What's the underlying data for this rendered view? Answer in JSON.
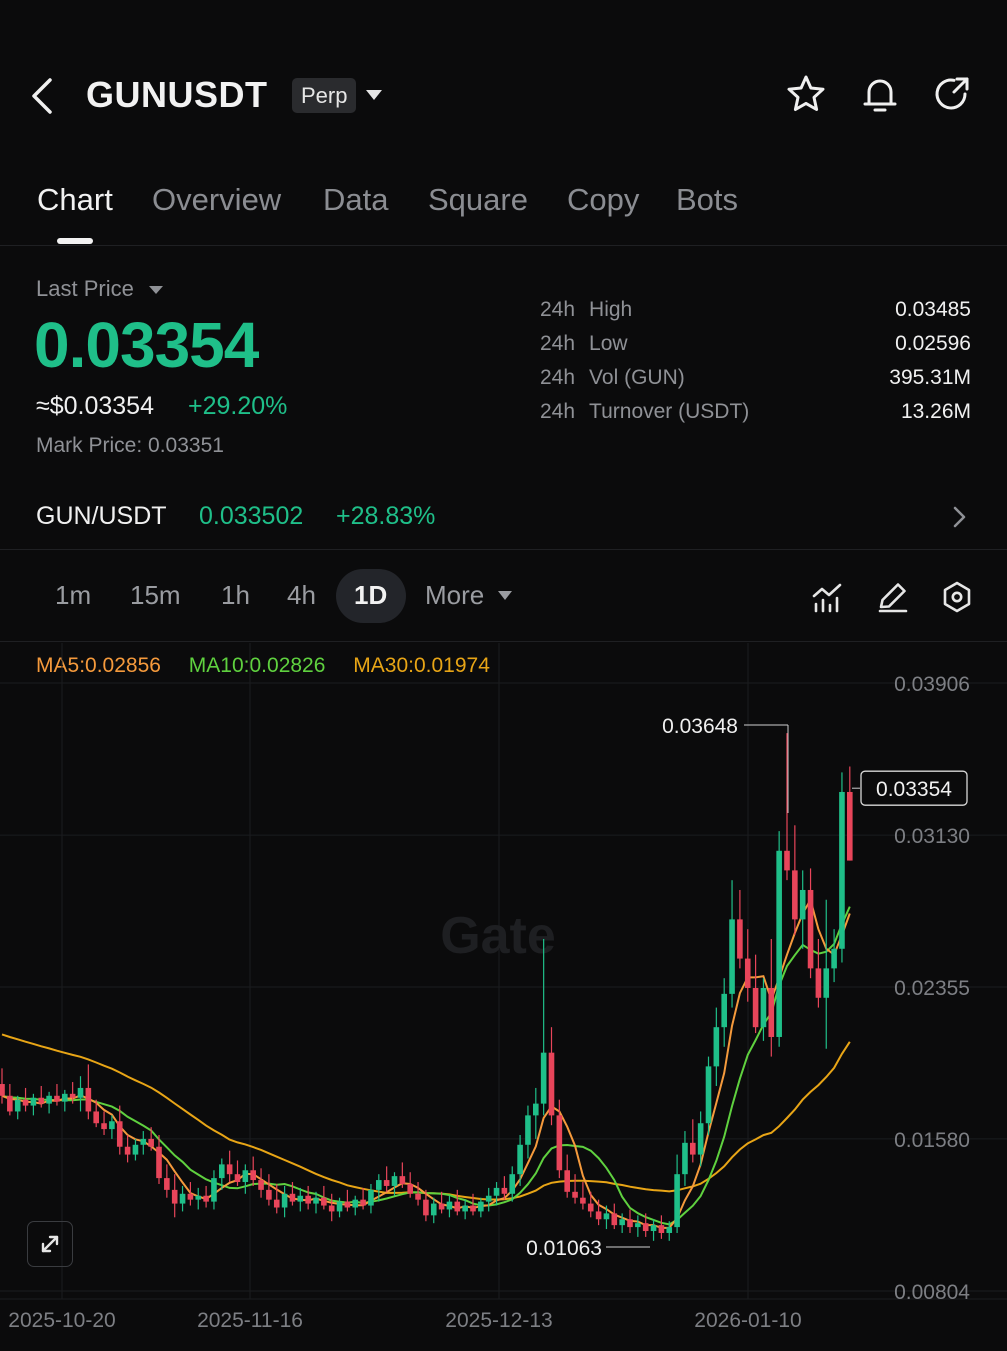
{
  "header": {
    "title": "GUNUSDT",
    "badge": "Perp",
    "icons": [
      "back-icon",
      "star-icon",
      "bell-icon",
      "share-icon"
    ]
  },
  "tabs": [
    {
      "label": "Chart",
      "active": true
    },
    {
      "label": "Overview"
    },
    {
      "label": "Data"
    },
    {
      "label": "Square"
    },
    {
      "label": "Copy"
    },
    {
      "label": "Bots"
    }
  ],
  "ticker": {
    "last_price_label": "Last Price",
    "last_price": "0.03354",
    "usd_price": "≈$0.03354",
    "change": "+29.20%",
    "mark_price": "Mark Price:  0.03351",
    "stats": [
      {
        "period": "24h",
        "label": "High",
        "value": "0.03485"
      },
      {
        "period": "24h",
        "label": "Low",
        "value": "0.02596"
      },
      {
        "period": "24h",
        "label": "Vol (GUN)",
        "value": "395.31M"
      },
      {
        "period": "24h",
        "label": "Turnover (USDT)",
        "value": "13.26M"
      }
    ]
  },
  "spot": {
    "pair": "GUN/USDT",
    "price": "0.033502",
    "change": "+28.83%"
  },
  "intervals": {
    "items": [
      "1m",
      "15m",
      "1h",
      "4h",
      "1D",
      "More"
    ],
    "selected": "1D"
  },
  "colors": {
    "up": "#1fbf89",
    "down": "#e8455a",
    "ma5": "#f59a3c",
    "ma10": "#5fd13f",
    "ma30": "#e8a516",
    "bg": "#0b0b0c"
  },
  "chart_data": {
    "type": "candlestick",
    "ma_legend": [
      {
        "name": "MA5",
        "value": "0.02856",
        "color": "#f59a3c"
      },
      {
        "name": "MA10",
        "value": "0.02826",
        "color": "#5fd13f"
      },
      {
        "name": "MA30",
        "value": "0.01974",
        "color": "#e8a516"
      }
    ],
    "y_ticks": [
      "0.03906",
      "0.03130",
      "0.02355",
      "0.01580",
      "0.00804"
    ],
    "ylim": [
      0.00804,
      0.03906
    ],
    "x_ticks": [
      "2025-10-20",
      "2025-11-16",
      "2025-12-13",
      "2026-01-10"
    ],
    "current_price": "0.03354",
    "annotations": {
      "high": "0.03648",
      "low": "0.01063"
    },
    "watermark": "Gate",
    "candles": [
      [
        0.0186,
        0.0194,
        0.0176,
        0.018
      ],
      [
        0.018,
        0.0186,
        0.017,
        0.0172
      ],
      [
        0.0172,
        0.018,
        0.0168,
        0.0178
      ],
      [
        0.0178,
        0.0184,
        0.0172,
        0.0175
      ],
      [
        0.0175,
        0.0181,
        0.017,
        0.0179
      ],
      [
        0.0179,
        0.0185,
        0.0174,
        0.0176
      ],
      [
        0.0176,
        0.0182,
        0.0171,
        0.018
      ],
      [
        0.018,
        0.0186,
        0.0175,
        0.0177
      ],
      [
        0.0177,
        0.0183,
        0.0172,
        0.0181
      ],
      [
        0.0181,
        0.0187,
        0.0176,
        0.0179
      ],
      [
        0.0179,
        0.019,
        0.0172,
        0.0184
      ],
      [
        0.0184,
        0.0196,
        0.0168,
        0.0172
      ],
      [
        0.0172,
        0.0178,
        0.0164,
        0.0166
      ],
      [
        0.0166,
        0.0172,
        0.016,
        0.0163
      ],
      [
        0.0163,
        0.017,
        0.0158,
        0.0167
      ],
      [
        0.0167,
        0.0175,
        0.015,
        0.0154
      ],
      [
        0.0154,
        0.016,
        0.0146,
        0.015
      ],
      [
        0.015,
        0.0158,
        0.0147,
        0.0155
      ],
      [
        0.0155,
        0.0162,
        0.015,
        0.0158
      ],
      [
        0.0158,
        0.0164,
        0.0152,
        0.0154
      ],
      [
        0.0154,
        0.016,
        0.0135,
        0.0138
      ],
      [
        0.0138,
        0.0145,
        0.0128,
        0.0132
      ],
      [
        0.0132,
        0.014,
        0.0118,
        0.0125
      ],
      [
        0.0125,
        0.0134,
        0.0121,
        0.013
      ],
      [
        0.013,
        0.0136,
        0.0124,
        0.0127
      ],
      [
        0.0127,
        0.0133,
        0.0122,
        0.0129
      ],
      [
        0.0129,
        0.0134,
        0.0123,
        0.0126
      ],
      [
        0.0126,
        0.0142,
        0.0122,
        0.0138
      ],
      [
        0.0138,
        0.0148,
        0.0132,
        0.0145
      ],
      [
        0.0145,
        0.0152,
        0.0136,
        0.014
      ],
      [
        0.014,
        0.0147,
        0.0134,
        0.0136
      ],
      [
        0.0136,
        0.0145,
        0.013,
        0.0142
      ],
      [
        0.0142,
        0.0149,
        0.0134,
        0.0137
      ],
      [
        0.0137,
        0.0143,
        0.0128,
        0.0132
      ],
      [
        0.0132,
        0.014,
        0.0124,
        0.0127
      ],
      [
        0.0127,
        0.0135,
        0.012,
        0.0123
      ],
      [
        0.0123,
        0.0134,
        0.0118,
        0.013
      ],
      [
        0.013,
        0.0136,
        0.0124,
        0.0126
      ],
      [
        0.0126,
        0.0133,
        0.0121,
        0.0129
      ],
      [
        0.0129,
        0.0134,
        0.0122,
        0.0125
      ],
      [
        0.0125,
        0.0131,
        0.012,
        0.0128
      ],
      [
        0.0128,
        0.0134,
        0.0122,
        0.0124
      ],
      [
        0.0124,
        0.013,
        0.0116,
        0.0121
      ],
      [
        0.0121,
        0.0128,
        0.0118,
        0.0126
      ],
      [
        0.0126,
        0.0132,
        0.0121,
        0.0123
      ],
      [
        0.0123,
        0.0129,
        0.0119,
        0.0127
      ],
      [
        0.0127,
        0.0133,
        0.0122,
        0.0124
      ],
      [
        0.0124,
        0.0135,
        0.012,
        0.0132
      ],
      [
        0.0132,
        0.014,
        0.0126,
        0.0137
      ],
      [
        0.0137,
        0.0144,
        0.0131,
        0.0134
      ],
      [
        0.0134,
        0.0141,
        0.0129,
        0.0139
      ],
      [
        0.0139,
        0.0146,
        0.0133,
        0.0135
      ],
      [
        0.0135,
        0.0141,
        0.0128,
        0.013
      ],
      [
        0.013,
        0.0136,
        0.0124,
        0.0127
      ],
      [
        0.0127,
        0.0132,
        0.0116,
        0.0119
      ],
      [
        0.0119,
        0.0128,
        0.0115,
        0.0125
      ],
      [
        0.0125,
        0.0131,
        0.012,
        0.0122
      ],
      [
        0.0122,
        0.0129,
        0.0118,
        0.0126
      ],
      [
        0.0126,
        0.0132,
        0.0119,
        0.0121
      ],
      [
        0.0121,
        0.0127,
        0.0117,
        0.0124
      ],
      [
        0.0124,
        0.013,
        0.0119,
        0.0121
      ],
      [
        0.0121,
        0.0128,
        0.0118,
        0.0126
      ],
      [
        0.0126,
        0.0133,
        0.0121,
        0.0129
      ],
      [
        0.0129,
        0.0136,
        0.0124,
        0.0133
      ],
      [
        0.0133,
        0.0139,
        0.0127,
        0.013
      ],
      [
        0.013,
        0.0144,
        0.0126,
        0.014
      ],
      [
        0.014,
        0.016,
        0.0134,
        0.0155
      ],
      [
        0.0155,
        0.0175,
        0.0148,
        0.017
      ],
      [
        0.017,
        0.0184,
        0.0158,
        0.0176
      ],
      [
        0.0176,
        0.026,
        0.017,
        0.0202
      ],
      [
        0.0202,
        0.0215,
        0.0165,
        0.017
      ],
      [
        0.017,
        0.0178,
        0.0138,
        0.0142
      ],
      [
        0.0142,
        0.015,
        0.0128,
        0.0131
      ],
      [
        0.0131,
        0.014,
        0.0125,
        0.0128
      ],
      [
        0.0128,
        0.0136,
        0.0122,
        0.0125
      ],
      [
        0.0125,
        0.0131,
        0.0118,
        0.0121
      ],
      [
        0.0121,
        0.0127,
        0.0114,
        0.0117
      ],
      [
        0.0117,
        0.0124,
        0.0112,
        0.012
      ],
      [
        0.012,
        0.0125,
        0.0112,
        0.0114
      ],
      [
        0.0114,
        0.012,
        0.011,
        0.0117
      ],
      [
        0.0117,
        0.0122,
        0.011,
        0.0113
      ],
      [
        0.0113,
        0.0119,
        0.0108,
        0.0115
      ],
      [
        0.0115,
        0.012,
        0.0108,
        0.0111
      ],
      [
        0.0111,
        0.0117,
        0.0106,
        0.0114
      ],
      [
        0.0114,
        0.0119,
        0.0107,
        0.011
      ],
      [
        0.011,
        0.0116,
        0.0106,
        0.0113
      ],
      [
        0.0113,
        0.015,
        0.011,
        0.014
      ],
      [
        0.014,
        0.0162,
        0.0134,
        0.0156
      ],
      [
        0.0156,
        0.0168,
        0.0146,
        0.015
      ],
      [
        0.015,
        0.0172,
        0.0144,
        0.0166
      ],
      [
        0.0166,
        0.02,
        0.016,
        0.0195
      ],
      [
        0.0195,
        0.0225,
        0.0185,
        0.0215
      ],
      [
        0.0215,
        0.024,
        0.0205,
        0.0232
      ],
      [
        0.0232,
        0.029,
        0.0225,
        0.027
      ],
      [
        0.027,
        0.0285,
        0.0245,
        0.025
      ],
      [
        0.025,
        0.0265,
        0.0228,
        0.0235
      ],
      [
        0.0235,
        0.0252,
        0.0212,
        0.0215
      ],
      [
        0.0215,
        0.024,
        0.0208,
        0.0235
      ],
      [
        0.0235,
        0.026,
        0.02,
        0.021
      ],
      [
        0.021,
        0.0315,
        0.0205,
        0.0305
      ],
      [
        0.0305,
        0.0365,
        0.029,
        0.0295
      ],
      [
        0.0295,
        0.0318,
        0.0262,
        0.027
      ],
      [
        0.027,
        0.0295,
        0.0255,
        0.0285
      ],
      [
        0.0285,
        0.0296,
        0.024,
        0.0245
      ],
      [
        0.0245,
        0.026,
        0.0225,
        0.023
      ],
      [
        0.023,
        0.028,
        0.0204,
        0.0245
      ],
      [
        0.0245,
        0.0265,
        0.0238,
        0.0255
      ],
      [
        0.0255,
        0.0345,
        0.0248,
        0.0335
      ],
      [
        0.0335,
        0.0348,
        0.03,
        0.03
      ]
    ]
  }
}
